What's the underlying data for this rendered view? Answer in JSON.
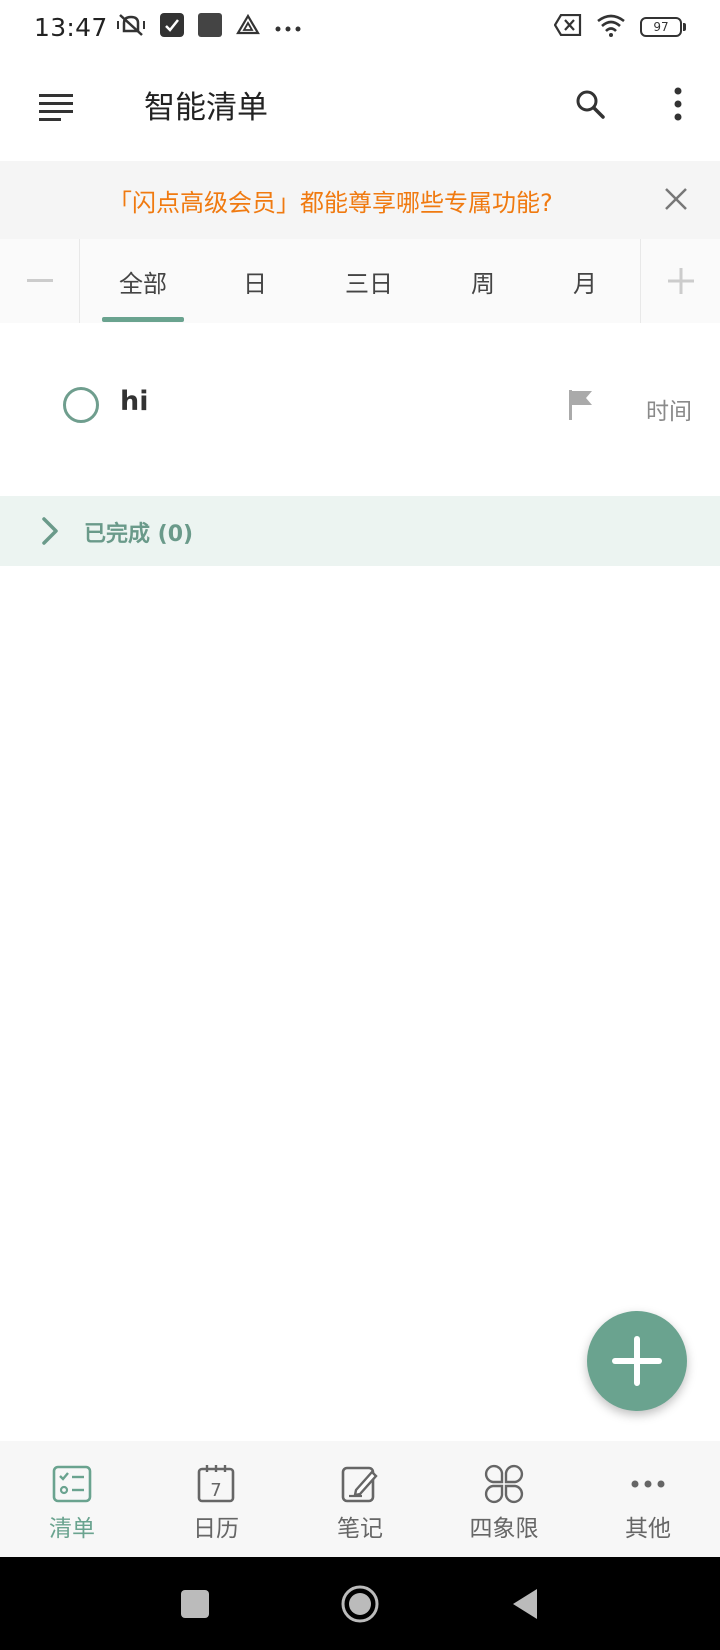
{
  "status_bar": {
    "time": "13:47",
    "battery": "97",
    "icons": [
      "mute-vibrate-icon",
      "app-notification-icon",
      "square-notification-icon",
      "drive-icon",
      "more-notifications-icon",
      "sim-off-icon",
      "wifi-icon",
      "battery-icon"
    ]
  },
  "app_bar": {
    "title": "智能清单",
    "icons": [
      "menu-icon",
      "search-icon",
      "more-vert-icon"
    ]
  },
  "promo": {
    "text": "「闪点高级会员」都能尊享哪些专属功能?"
  },
  "tabs": {
    "items": [
      "全部",
      "日",
      "三日",
      "周",
      "月"
    ],
    "active_index": 0
  },
  "tasks": [
    {
      "title": "hi",
      "time_label": "时间",
      "completed": false
    }
  ],
  "completed_section": {
    "label": "已完成 (0)"
  },
  "bottom_nav": {
    "items": [
      {
        "label": "清单",
        "icon": "checklist-icon",
        "active": true
      },
      {
        "label": "日历",
        "icon": "calendar-icon",
        "date_number": "7",
        "active": false
      },
      {
        "label": "笔记",
        "icon": "note-edit-icon",
        "active": false
      },
      {
        "label": "四象限",
        "icon": "quadrant-icon",
        "active": false
      },
      {
        "label": "其他",
        "icon": "more-horiz-icon",
        "active": false
      }
    ]
  },
  "colors": {
    "accent": "#6aa38f",
    "promo_text": "#f07a10",
    "completed_bg": "#ecf4f1"
  }
}
